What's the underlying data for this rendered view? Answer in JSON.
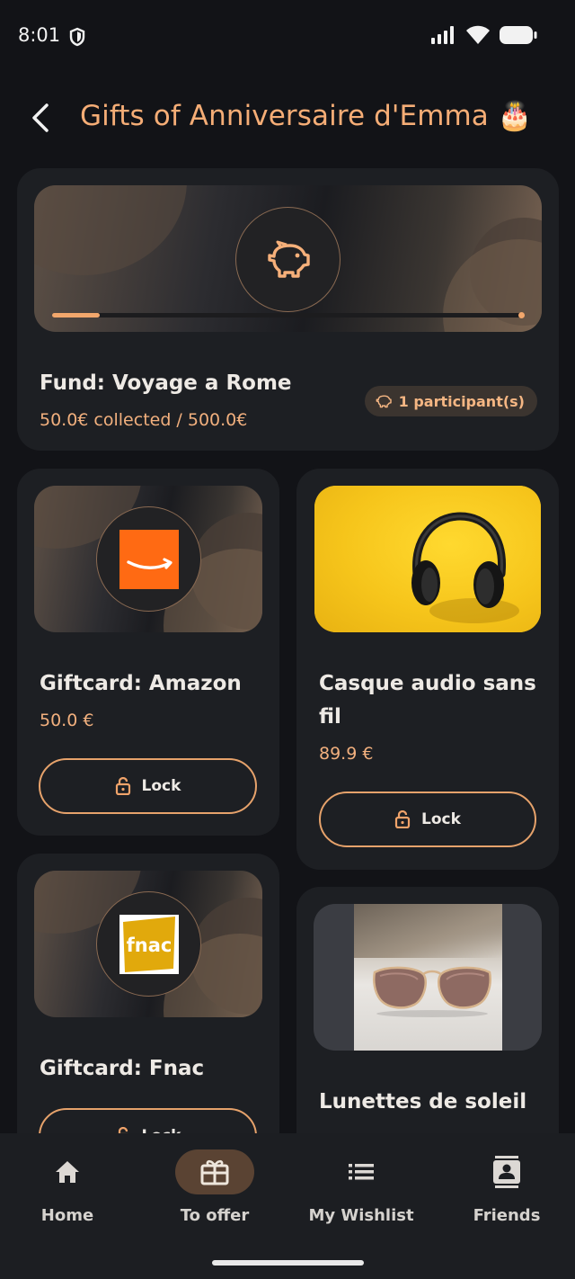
{
  "status": {
    "time": "8:01"
  },
  "header": {
    "title": "Gifts of Anniversaire d'Emma 🎂"
  },
  "fund": {
    "title": "Fund: Voyage a Rome",
    "collected": "50.0€ collected / 500.0€",
    "participants": "1 participant(s)",
    "progress": 0.1,
    "icon": "piggy-bank-icon"
  },
  "gifts": [
    {
      "title": "Giftcard: Amazon",
      "price": "50.0 €",
      "lock_label": "Lock",
      "brand": "amazon-logo"
    },
    {
      "title": "Casque audio sans fil",
      "price": "89.9 €",
      "lock_label": "Lock",
      "image": "headphones-photo"
    },
    {
      "title": "Giftcard: Fnac",
      "price": "",
      "lock_label": "Lock",
      "brand": "fnac-logo",
      "brand_text": "fnac"
    },
    {
      "title": "Lunettes de soleil",
      "price": "",
      "image": "sunglasses-photo"
    }
  ],
  "nav": {
    "items": [
      {
        "label": "Home",
        "icon": "home-icon"
      },
      {
        "label": "To offer",
        "icon": "gift-icon",
        "active": true
      },
      {
        "label": "My Wishlist",
        "icon": "list-icon"
      },
      {
        "label": "Friends",
        "icon": "contact-icon"
      }
    ]
  },
  "colors": {
    "accent": "#f5ad76",
    "background": "#121317",
    "card": "#1d1f23",
    "amazon": "#ff6a13",
    "fnac": "#e1a90c"
  }
}
